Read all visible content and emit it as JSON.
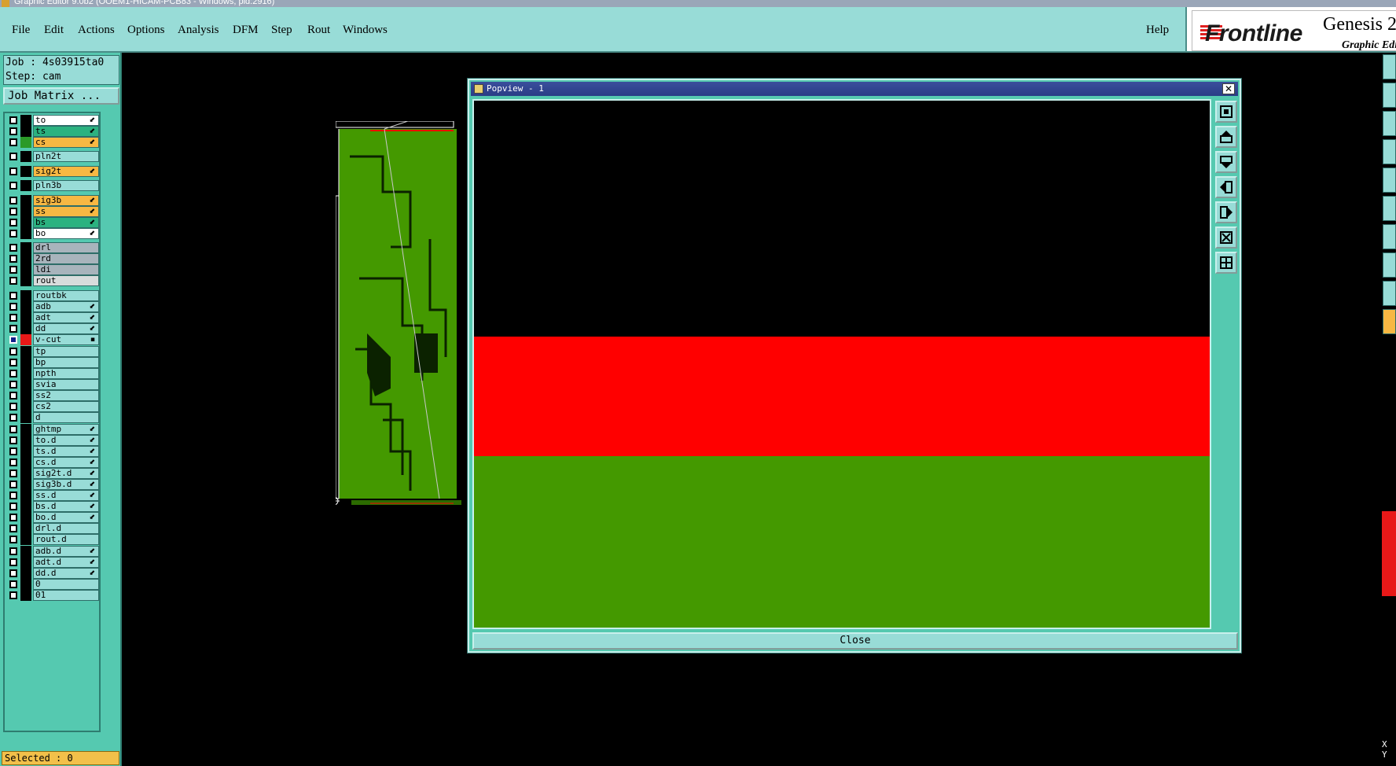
{
  "window": {
    "title": "Graphic Editor 9.0b2 (OOEM1-HICAM-PCB83 - Windows, pid:2916)"
  },
  "menu": [
    {
      "label": "File"
    },
    {
      "label": "Edit"
    },
    {
      "label": "Actions"
    },
    {
      "label": "Options"
    },
    {
      "label": "Analysis"
    },
    {
      "label": "DFM"
    },
    {
      "label": "Step"
    },
    {
      "label": "Rout"
    },
    {
      "label": "Windows"
    },
    {
      "label": "Help"
    }
  ],
  "brand": {
    "logo": "Frontline",
    "product": "Genesis 2",
    "subtitle": "Graphic Edi"
  },
  "job": {
    "job_line": "Job : 4s03915ta0",
    "step_line": "Step: cam",
    "matrix_button": "Job Matrix ..."
  },
  "layers": [
    {
      "name": "to",
      "bg": "#ffffff",
      "swatch": "#000000",
      "arrow": "⬋",
      "checked": false
    },
    {
      "name": "ts",
      "bg": "#2bb280",
      "swatch": "#000000",
      "arrow": "⬋",
      "checked": false
    },
    {
      "name": "cs",
      "bg": "#f7b843",
      "swatch": "#2b9a28",
      "arrow": "⬋",
      "checked": false
    },
    {
      "name": "pln2t",
      "bg": "#98dcd7",
      "swatch": "#000000",
      "arrow": "",
      "checked": false
    },
    {
      "name": "sig2t",
      "bg": "#f7b843",
      "swatch": "#000000",
      "arrow": "⬋",
      "checked": false
    },
    {
      "name": "pln3b",
      "bg": "#98dcd7",
      "swatch": "#000000",
      "arrow": "",
      "checked": false
    },
    {
      "name": "sig3b",
      "bg": "#f7b843",
      "swatch": "#000000",
      "arrow": "⬋",
      "checked": false
    },
    {
      "name": "ss",
      "bg": "#f7b843",
      "swatch": "#000000",
      "arrow": "⬋",
      "checked": false
    },
    {
      "name": "bs",
      "bg": "#2bb280",
      "swatch": "#000000",
      "arrow": "⬋",
      "checked": false
    },
    {
      "name": "bo",
      "bg": "#ffffff",
      "swatch": "#000000",
      "arrow": "⬋",
      "checked": false
    },
    {
      "name": "drl",
      "bg": "#a8b4bc",
      "swatch": "#000000",
      "arrow": "",
      "checked": false
    },
    {
      "name": "2rd",
      "bg": "#a8b4bc",
      "swatch": "#000000",
      "arrow": "",
      "checked": false
    },
    {
      "name": "ldi",
      "bg": "#a8b4bc",
      "swatch": "#000000",
      "arrow": "",
      "checked": false
    },
    {
      "name": "rout",
      "bg": "#d8dcdc",
      "swatch": "#000000",
      "arrow": "",
      "checked": false
    },
    {
      "name": "routbk",
      "bg": "#98dcd7",
      "swatch": "#000000",
      "arrow": "",
      "checked": false
    },
    {
      "name": "adb",
      "bg": "#98dcd7",
      "swatch": "#000000",
      "arrow": "⬋",
      "checked": false
    },
    {
      "name": "adt",
      "bg": "#98dcd7",
      "swatch": "#000000",
      "arrow": "⬋",
      "checked": false
    },
    {
      "name": "dd",
      "bg": "#98dcd7",
      "swatch": "#000000",
      "arrow": "⬋",
      "checked": false
    },
    {
      "name": "v-cut",
      "bg": "#98dcd7",
      "swatch": "#e81818",
      "arrow": "▪",
      "checked": true
    },
    {
      "name": "tp",
      "bg": "#98dcd7",
      "swatch": "#000000",
      "arrow": "",
      "checked": false
    },
    {
      "name": "bp",
      "bg": "#98dcd7",
      "swatch": "#000000",
      "arrow": "",
      "checked": false
    },
    {
      "name": "npth",
      "bg": "#98dcd7",
      "swatch": "#000000",
      "arrow": "",
      "checked": false
    },
    {
      "name": "svia",
      "bg": "#98dcd7",
      "swatch": "#000000",
      "arrow": "",
      "checked": false
    },
    {
      "name": "ss2",
      "bg": "#98dcd7",
      "swatch": "#000000",
      "arrow": "",
      "checked": false
    },
    {
      "name": "cs2",
      "bg": "#98dcd7",
      "swatch": "#000000",
      "arrow": "",
      "checked": false
    },
    {
      "name": "d",
      "bg": "#98dcd7",
      "swatch": "#000000",
      "arrow": "",
      "checked": false
    },
    {
      "name": "ghtmp",
      "bg": "#98dcd7",
      "swatch": "#000000",
      "arrow": "⬋",
      "checked": false
    },
    {
      "name": "to.d",
      "bg": "#98dcd7",
      "swatch": "#000000",
      "arrow": "⬋",
      "checked": false
    },
    {
      "name": "ts.d",
      "bg": "#98dcd7",
      "swatch": "#000000",
      "arrow": "⬋",
      "checked": false
    },
    {
      "name": "cs.d",
      "bg": "#98dcd7",
      "swatch": "#000000",
      "arrow": "⬋",
      "checked": false
    },
    {
      "name": "sig2t.d",
      "bg": "#98dcd7",
      "swatch": "#000000",
      "arrow": "⬋",
      "checked": false
    },
    {
      "name": "sig3b.d",
      "bg": "#98dcd7",
      "swatch": "#000000",
      "arrow": "⬋",
      "checked": false
    },
    {
      "name": "ss.d",
      "bg": "#98dcd7",
      "swatch": "#000000",
      "arrow": "⬋",
      "checked": false
    },
    {
      "name": "bs.d",
      "bg": "#98dcd7",
      "swatch": "#000000",
      "arrow": "⬋",
      "checked": false
    },
    {
      "name": "bo.d",
      "bg": "#98dcd7",
      "swatch": "#000000",
      "arrow": "⬋",
      "checked": false
    },
    {
      "name": "drl.d",
      "bg": "#98dcd7",
      "swatch": "#000000",
      "arrow": "",
      "checked": false
    },
    {
      "name": "rout.d",
      "bg": "#98dcd7",
      "swatch": "#000000",
      "arrow": "",
      "checked": false
    },
    {
      "name": "adb.d",
      "bg": "#98dcd7",
      "swatch": "#000000",
      "arrow": "⬋",
      "checked": false
    },
    {
      "name": "adt.d",
      "bg": "#98dcd7",
      "swatch": "#000000",
      "arrow": "⬋",
      "checked": false
    },
    {
      "name": "dd.d",
      "bg": "#98dcd7",
      "swatch": "#000000",
      "arrow": "⬋",
      "checked": false
    },
    {
      "name": "0",
      "bg": "#98dcd7",
      "swatch": "#000000",
      "arrow": "",
      "checked": false
    },
    {
      "name": "01",
      "bg": "#98dcd7",
      "swatch": "#000000",
      "arrow": "",
      "checked": false
    }
  ],
  "status": {
    "selected": "Selected : 0",
    "coord_x": "X",
    "coord_y": "Y"
  },
  "popview": {
    "title": "Popview - 1",
    "close_x": "✕",
    "close_button": "Close",
    "tools": [
      "zoom-fit-icon",
      "pan-up-icon",
      "pan-down-icon",
      "pan-left-icon",
      "pan-right-icon",
      "zoom-in-icon",
      "zoom-out-icon"
    ]
  },
  "colors": {
    "panel": "#55c9b0",
    "menubar": "#98dcd7",
    "pcb_green": "#449900",
    "copper_red": "#ff0000",
    "highlight": "#f7b843"
  }
}
